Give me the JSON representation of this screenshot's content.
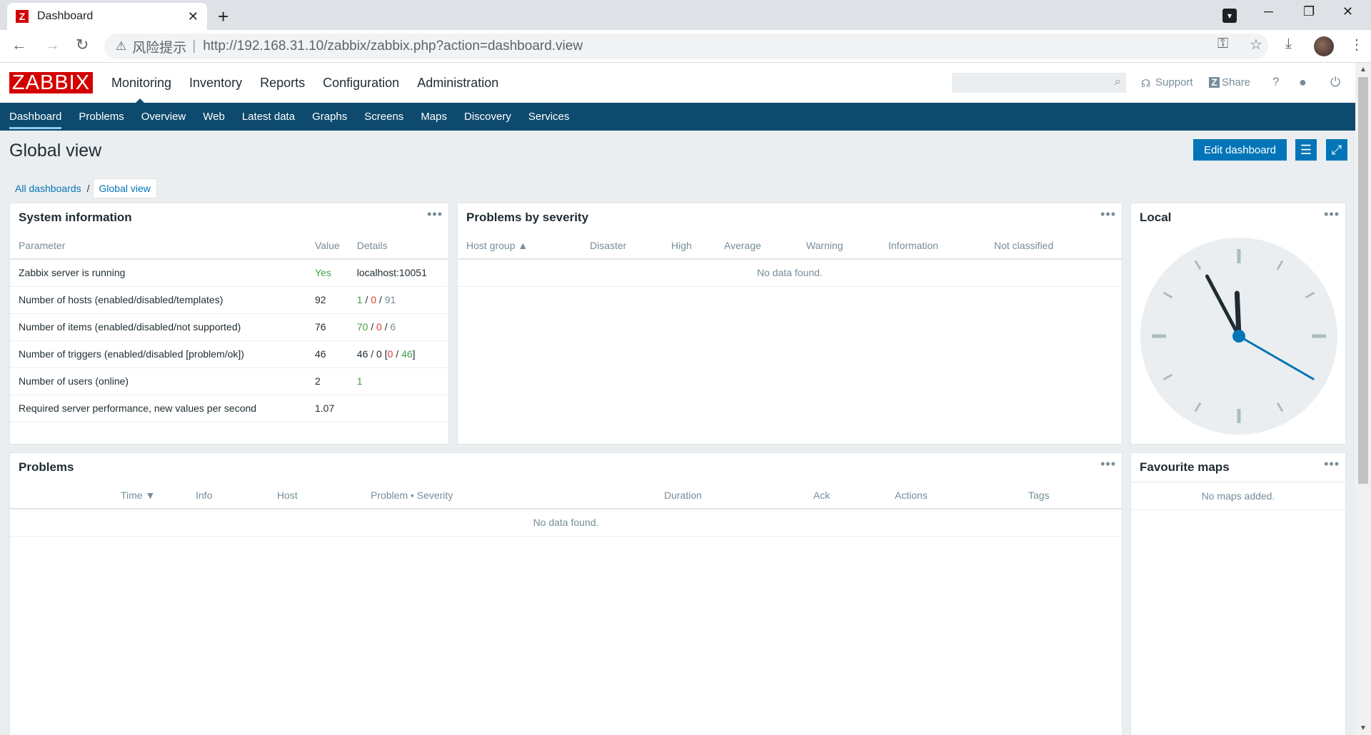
{
  "browser": {
    "tab_title": "Dashboard",
    "favicon": "Z",
    "risk_label": "风险提示",
    "url": "http://192.168.31.10/zabbix/zabbix.php?action=dashboard.view"
  },
  "header": {
    "logo": "ZABBIX",
    "menu": [
      {
        "label": "Monitoring"
      },
      {
        "label": "Inventory"
      },
      {
        "label": "Reports"
      },
      {
        "label": "Configuration"
      },
      {
        "label": "Administration"
      }
    ],
    "support_label": "Support",
    "share_label": "Share",
    "help_label": "?"
  },
  "subnav": [
    {
      "label": "Dashboard"
    },
    {
      "label": "Problems"
    },
    {
      "label": "Overview"
    },
    {
      "label": "Web"
    },
    {
      "label": "Latest data"
    },
    {
      "label": "Graphs"
    },
    {
      "label": "Screens"
    },
    {
      "label": "Maps"
    },
    {
      "label": "Discovery"
    },
    {
      "label": "Services"
    }
  ],
  "page": {
    "title": "Global view",
    "edit_button": "Edit dashboard",
    "breadcrumb_all": "All dashboards",
    "breadcrumb_sep": "/",
    "breadcrumb_current": "Global view"
  },
  "sysinfo": {
    "title": "System information",
    "headers": [
      "Parameter",
      "Value",
      "Details"
    ],
    "rows": [
      {
        "param": "Zabbix server is running",
        "value": "Yes",
        "details": "localhost:10051"
      },
      {
        "param": "Number of hosts (enabled/disabled/templates)",
        "value": "92",
        "d1": "1",
        "d2": "0",
        "d3": "91"
      },
      {
        "param": "Number of items (enabled/disabled/not supported)",
        "value": "76",
        "d1": "70",
        "d2": "0",
        "d3": "6"
      },
      {
        "param": "Number of triggers (enabled/disabled [problem/ok])",
        "value": "46",
        "d_prefix": "46 / 0 [",
        "d1": "0",
        "d2": "46",
        "d_suffix": "]"
      },
      {
        "param": "Number of users (online)",
        "value": "2",
        "details": "1"
      },
      {
        "param": "Required server performance, new values per second",
        "value": "1.07",
        "details": ""
      }
    ]
  },
  "severity": {
    "title": "Problems by severity",
    "headers": [
      "Host group ▲",
      "Disaster",
      "High",
      "Average",
      "Warning",
      "Information",
      "Not classified"
    ],
    "no_data": "No data found."
  },
  "clock": {
    "title": "Local",
    "hour": 11,
    "minute": 55,
    "second": 20
  },
  "problems": {
    "title": "Problems",
    "headers": [
      "Time ▼",
      "Info",
      "Host",
      "Problem • Severity",
      "Duration",
      "Ack",
      "Actions",
      "Tags"
    ],
    "no_data": "No data found."
  },
  "favmaps": {
    "title": "Favourite maps",
    "no_data": "No maps added."
  },
  "colors": {
    "brand_red": "#d40000",
    "nav_blue": "#0e4a6e",
    "accent_blue": "#0275b8",
    "ok_green": "#429e47",
    "problem_red": "#e33734"
  }
}
